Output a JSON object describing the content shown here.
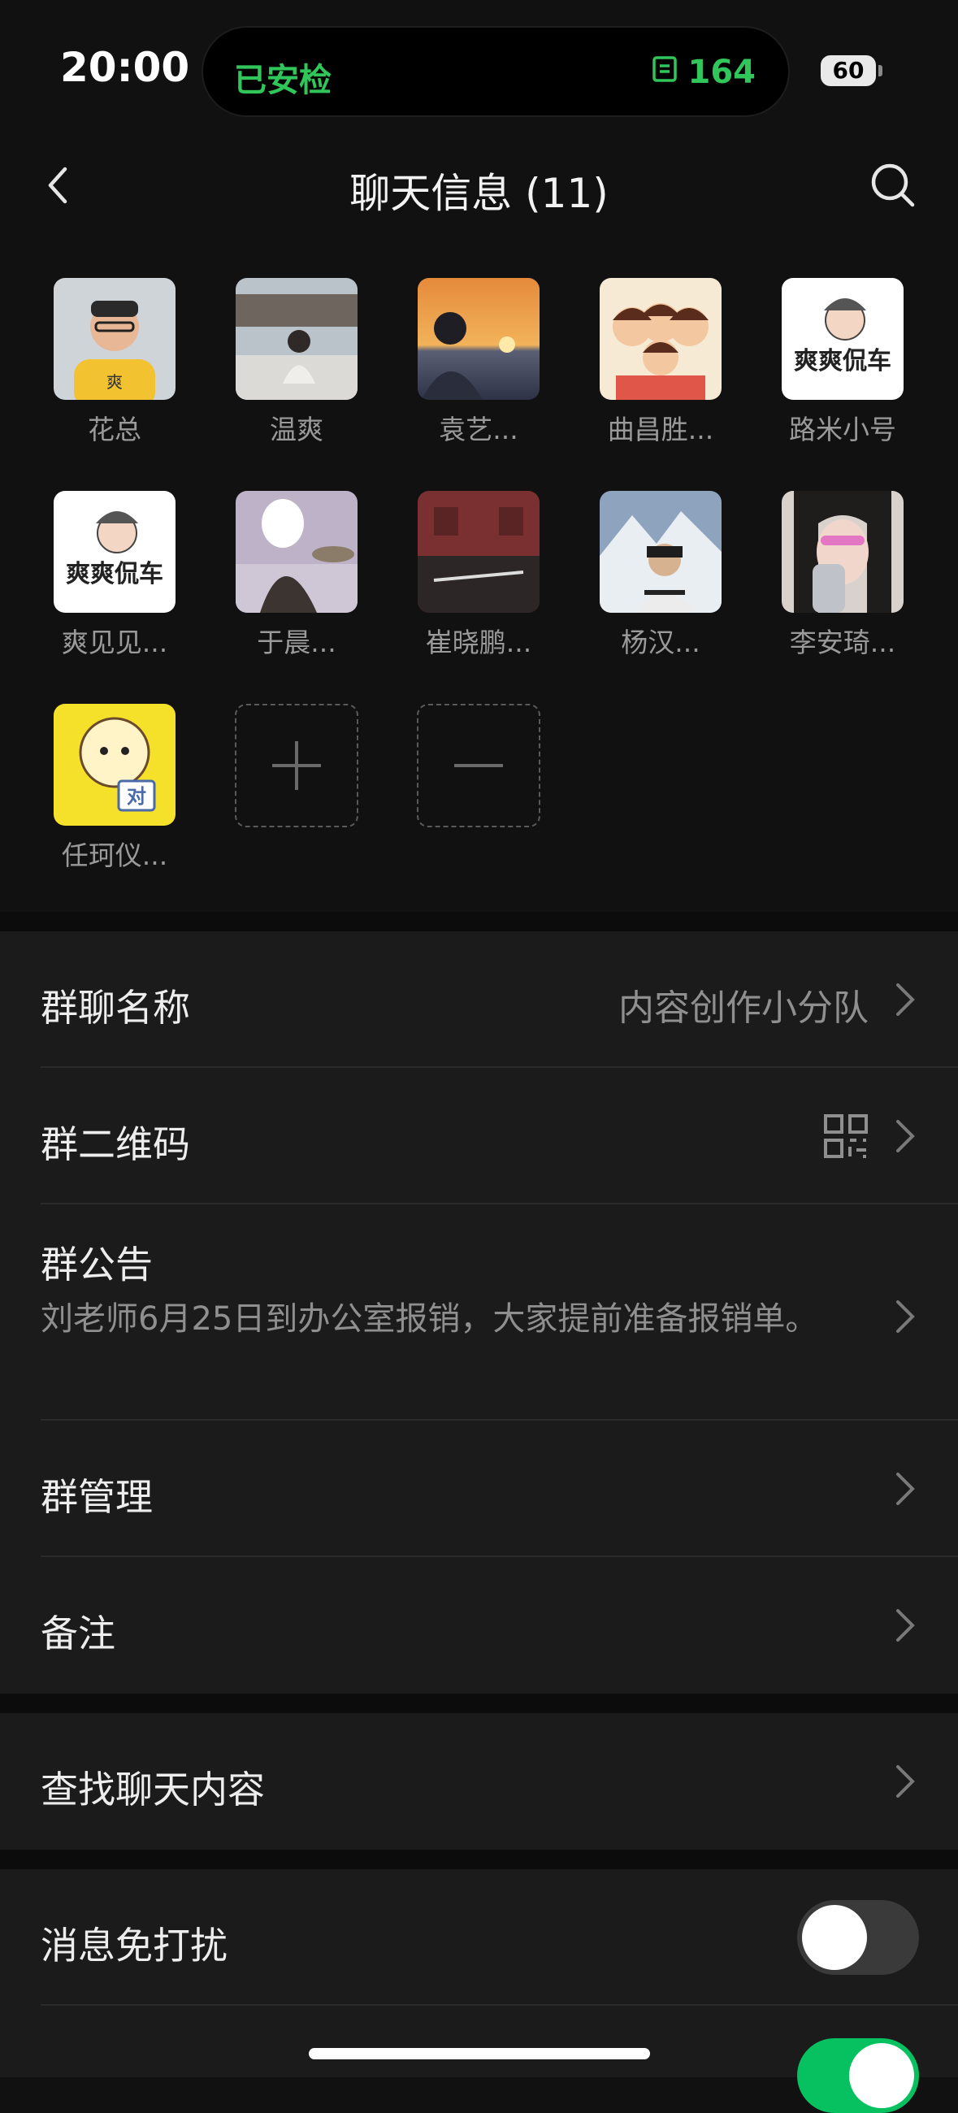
{
  "status_bar": {
    "time": "20:00",
    "island_left": "已安检",
    "island_right_icon": "frame-icon",
    "island_right": "164",
    "battery": "60"
  },
  "nav": {
    "title": "聊天信息 (11)"
  },
  "members": [
    {
      "name": "花总"
    },
    {
      "name": "温爽"
    },
    {
      "name": "袁艺..."
    },
    {
      "name": "曲昌胜..."
    },
    {
      "name": "路米小号"
    },
    {
      "name": "爽见见..."
    },
    {
      "name": "于晨..."
    },
    {
      "name": "崔晓鹏..."
    },
    {
      "name": "杨汉..."
    },
    {
      "name": "李安琦..."
    },
    {
      "name": "任珂仪..."
    }
  ],
  "avatar_text": {
    "shuang_logo": "爽爽侃车",
    "badge": "对",
    "shirt": "爽"
  },
  "settings": {
    "group_name_label": "群聊名称",
    "group_name_value": "内容创作小分队",
    "qr_label": "群二维码",
    "notice_label": "群公告",
    "notice_text": "刘老师6月25日到办公室报销，大家提前准备报销单。",
    "manage_label": "群管理",
    "remark_label": "备注",
    "search_label": "查找聊天内容",
    "mute_label": "消息免打扰",
    "mute_on": false
  },
  "colors": {
    "accent_green": "#07c160",
    "status_green": "#30c65a"
  }
}
